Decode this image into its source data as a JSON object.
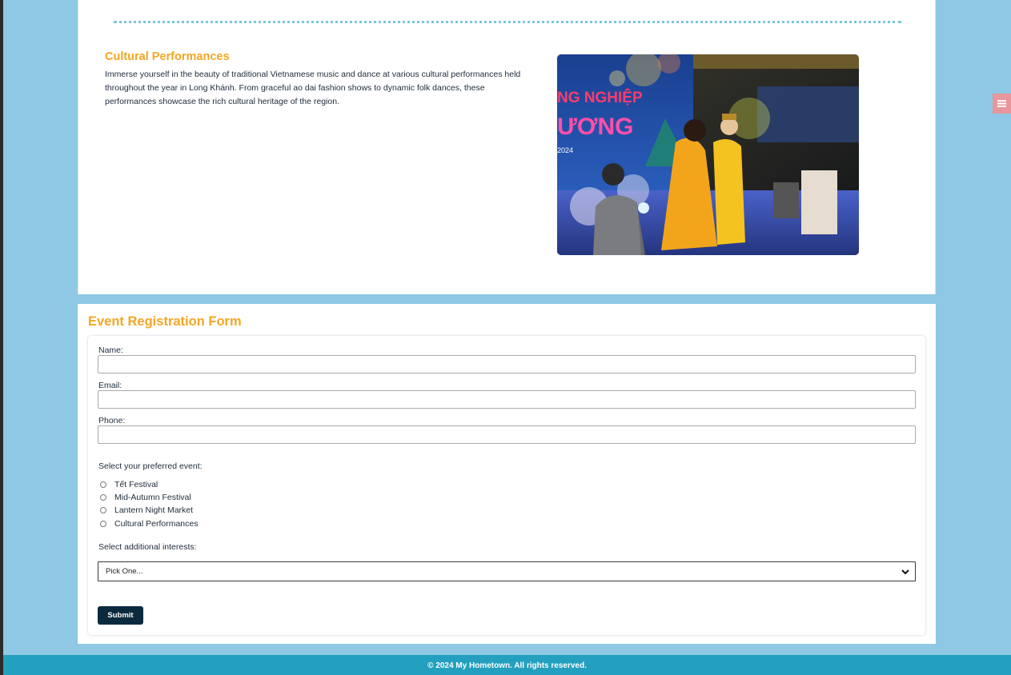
{
  "performances": {
    "title": "Cultural Performances",
    "description": "Immerse yourself in the beauty of traditional Vietnamese music and dance at various cultural performances held throughout the year in Long Khánh. From graceful ao dai fashion shows to dynamic folk dances, these performances showcase the rich cultural heritage of the region.",
    "photo_banner_line1": "NG NGHIỆP",
    "photo_banner_line2": "ƯƠNG",
    "photo_banner_year": "2024"
  },
  "form": {
    "title": "Event Registration Form",
    "name_label": "Name:",
    "name_value": "",
    "email_label": "Email:",
    "email_value": "",
    "phone_label": "Phone:",
    "phone_value": "",
    "event_prompt": "Select your preferred event:",
    "events": [
      {
        "label": "Tết Festival"
      },
      {
        "label": "Mid-Autumn Festival"
      },
      {
        "label": "Lantern Night Market"
      },
      {
        "label": "Cultural Performances"
      }
    ],
    "interests_prompt": "Select additional interests:",
    "interests_selected": "Pick One...",
    "submit_label": "Submit"
  },
  "footer": {
    "text": "© 2024 My Hometown. All rights reserved."
  },
  "icons": {
    "menu_toggle": "hamburger-menu-icon",
    "select_chevron": "chevron-down-icon"
  },
  "colors": {
    "page_bg": "#8ec8e4",
    "accent_heading": "#f5a623",
    "button_bg": "#0b2a3e",
    "footer_bg": "#239fbf",
    "menu_toggle_bg": "#e8969c"
  }
}
